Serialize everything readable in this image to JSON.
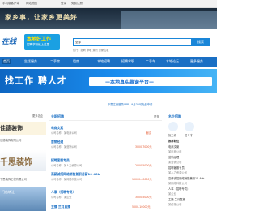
{
  "topbar": {
    "left_links": [
      "手机版客户端",
      "网站地图"
    ],
    "right_links": [
      "登录",
      "免费注册"
    ]
  },
  "hero": {
    "slogan": "家乡事，让家乡更美好"
  },
  "header": {
    "logo_text": "在线",
    "badge_main": "本地好工作",
    "badge_sub": "招聘求职就上这里",
    "search_select": "全部",
    "search_placeholder": "",
    "search_button": "搜索",
    "hot_label": "热门：招聘 求职 兼职 房屋出租"
  },
  "nav": {
    "items": [
      "首页",
      "生活服务",
      "二手房",
      "租房",
      "本地招聘",
      "招聘求职",
      "二手车",
      "本地论坛",
      "商家推荐",
      "更多服务"
    ],
    "active_index": 0
  },
  "banner": {
    "big": "找工作 聘人才",
    "sub": "—本地真实靠谱平台—"
  },
  "left": {
    "header_label": "",
    "header_more": "更多名企",
    "ad1_text": "佳德装饰",
    "ad1_caption": "佳德装饰有限公司",
    "ad2_text": "千思装饰",
    "ad2_caption": "千思装饰工程有限公司",
    "ad3_text": "门店转让",
    "ad3_caption": "创业好项目"
  },
  "middle": {
    "header_title": "全职招聘",
    "header_more": "更多",
    "post_link": "下载注册登录APP，9月30可免费申请",
    "jobs": [
      {
        "title": "电商文案",
        "company": "公司名称：某电商公司",
        "salary": "面议"
      },
      {
        "title": "营销经理",
        "company": "公司名称：某营销公司",
        "salary": "3000-7000元"
      },
      {
        "title": "招聘客服专员",
        "company": "公司名称：某人力资源公司",
        "salary": "2000-5000元"
      },
      {
        "title": "高薪诚招网络销售兼职月薪10-40k",
        "company": "公司名称：某网络科技公司",
        "salary": "10000-40000元"
      },
      {
        "title": "人事（招聘专员）",
        "company": "公司名称：某企业",
        "salary": "3000-5000元"
      },
      {
        "title": "主播 兰月直播",
        "company": "公司名称：某传媒公司",
        "salary": "5000-10000元"
      }
    ]
  },
  "right": {
    "header_title": "名企招聘",
    "header_sub": "找工作",
    "header_sub2": "招人才",
    "section": "推荐职位",
    "section_more": "更多",
    "items": [
      {
        "title": "电商文案",
        "company": "某电商公司"
      },
      {
        "title": "营销经理",
        "company": "某营销公司"
      },
      {
        "title": "招聘客服专员",
        "company": "某人力资源公司"
      },
      {
        "title": "高薪诚招网络销售兼职10-40k",
        "company": "某网络科技公司"
      },
      {
        "title": "人事（招聘专员）",
        "company": "某企业"
      },
      {
        "title": "主播 兰月直播",
        "company": "某传媒公司"
      }
    ]
  }
}
